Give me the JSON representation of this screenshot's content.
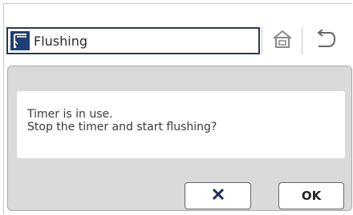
{
  "header": {
    "title": "Flushing",
    "app_icon": "flushing-valve-icon",
    "home_icon": "home-icon",
    "back_icon": "back-arrow-icon"
  },
  "dialog": {
    "message_line1": "Timer is in use.",
    "message_line2": "Stop the timer and start flushing?",
    "cancel_icon": "close-icon",
    "ok_label": "OK"
  },
  "colors": {
    "title_border": "#2b3a4a",
    "app_icon_bg": "#1f3e73",
    "dialog_bg": "#dadada"
  }
}
